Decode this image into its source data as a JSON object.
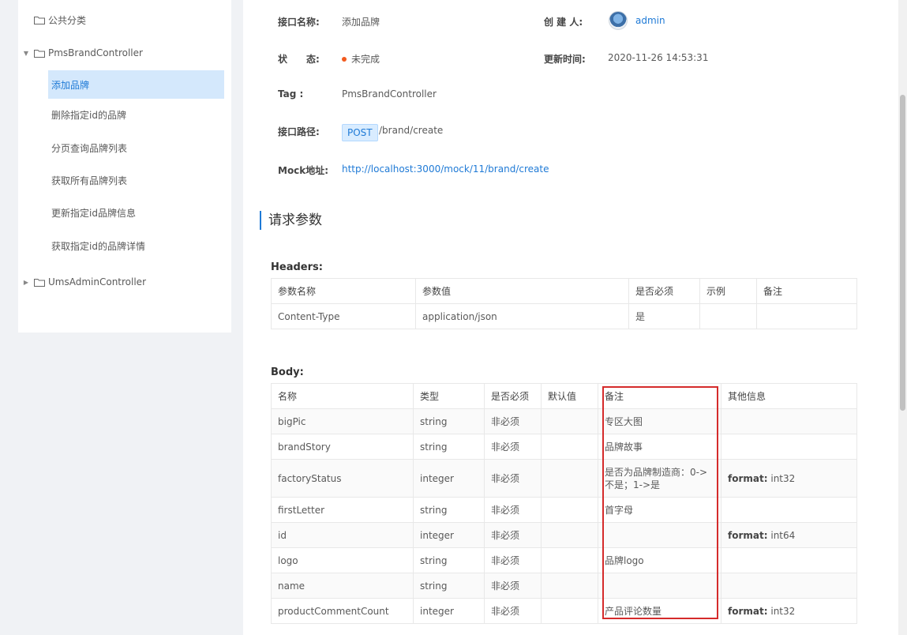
{
  "sidebar": {
    "groups": [
      {
        "label": "公共分类"
      },
      {
        "label": "PmsBrandController"
      },
      {
        "label": "UmsAdminController"
      }
    ],
    "items": [
      {
        "label": "添加品牌"
      },
      {
        "label": "删除指定id的品牌"
      },
      {
        "label": "分页查询品牌列表"
      },
      {
        "label": "获取所有品牌列表"
      },
      {
        "label": "更新指定id品牌信息"
      },
      {
        "label": "获取指定id的品牌详情"
      }
    ]
  },
  "info": {
    "name_label": "接口名称:",
    "name_value": "添加品牌",
    "creator_label": "创 建 人:",
    "creator_value": "admin",
    "status_label": "状　　态:",
    "status_value": "未完成",
    "updated_label": "更新时间:",
    "updated_value": "2020-11-26 14:53:31",
    "tag_label": "Tag :",
    "tag_value": "PmsBrandController",
    "path_label": "接口路径:",
    "method": "POST",
    "path_value": "/brand/create",
    "mock_label": "Mock地址:",
    "mock_value": "http://localhost:3000/mock/11/brand/create",
    "status_color": "#f25a1e"
  },
  "request": {
    "title": "请求参数",
    "headers_title": "Headers:",
    "headers_columns": [
      "参数名称",
      "参数值",
      "是否必须",
      "示例",
      "备注"
    ],
    "headers_rows": [
      [
        "Content-Type",
        "application/json",
        "是",
        "",
        ""
      ]
    ],
    "body_title": "Body:",
    "body_columns": [
      "名称",
      "类型",
      "是否必须",
      "默认值",
      "备注",
      "其他信息"
    ],
    "format_label": "format:",
    "body_rows": [
      {
        "name": "bigPic",
        "type": "string",
        "required": "非必须",
        "default": "",
        "note": "专区大图",
        "other": ""
      },
      {
        "name": "brandStory",
        "type": "string",
        "required": "非必须",
        "default": "",
        "note": "品牌故事",
        "other": ""
      },
      {
        "name": "factoryStatus",
        "type": "integer",
        "required": "非必须",
        "default": "",
        "note": "是否为品牌制造商：0->不是；1->是",
        "other": "int32"
      },
      {
        "name": "firstLetter",
        "type": "string",
        "required": "非必须",
        "default": "",
        "note": "首字母",
        "other": ""
      },
      {
        "name": "id",
        "type": "integer",
        "required": "非必须",
        "default": "",
        "note": "",
        "other": "int64"
      },
      {
        "name": "logo",
        "type": "string",
        "required": "非必须",
        "default": "",
        "note": "品牌logo",
        "other": ""
      },
      {
        "name": "name",
        "type": "string",
        "required": "非必须",
        "default": "",
        "note": "",
        "other": ""
      },
      {
        "name": "productCommentCount",
        "type": "integer",
        "required": "非必须",
        "default": "",
        "note": "产品评论数量",
        "other": "int32"
      }
    ]
  }
}
